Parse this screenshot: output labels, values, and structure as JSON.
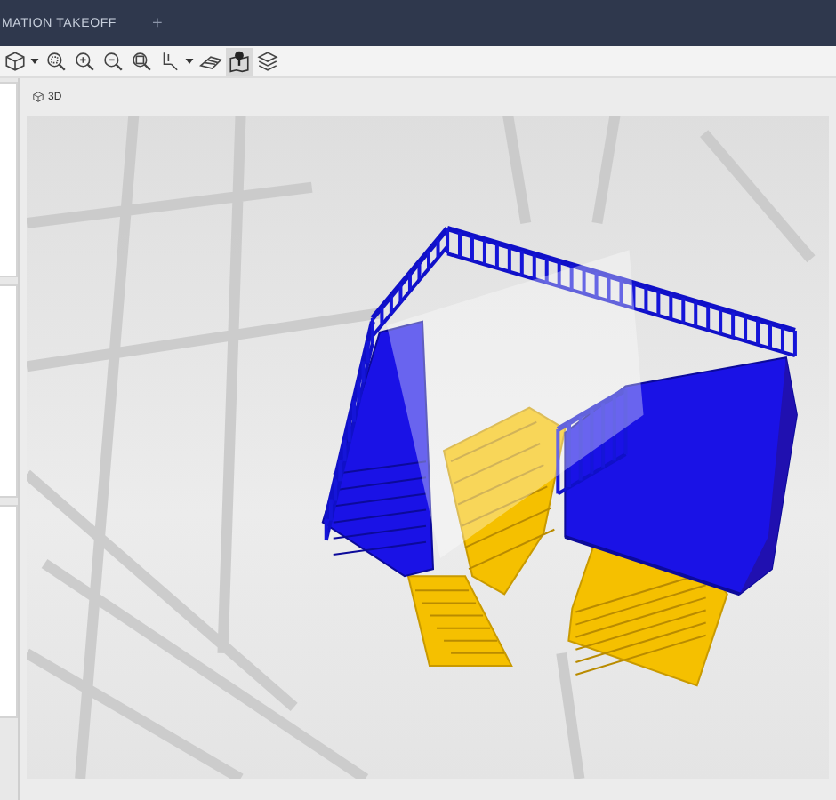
{
  "tabs": [
    {
      "label": "MATION TAKEOFF",
      "selected": true
    }
  ],
  "new_tab": "+",
  "toolbar": [
    {
      "kind": "cube",
      "dropdown": true,
      "selected": false
    },
    {
      "kind": "zoom-fit",
      "dropdown": false,
      "selected": false
    },
    {
      "kind": "zoom-in",
      "dropdown": false,
      "selected": false
    },
    {
      "kind": "zoom-out",
      "dropdown": false,
      "selected": false
    },
    {
      "kind": "zoom-window",
      "dropdown": false,
      "selected": false
    },
    {
      "kind": "pointer",
      "dropdown": true,
      "selected": false
    },
    {
      "kind": "plane",
      "dropdown": false,
      "selected": false
    },
    {
      "kind": "map-pin",
      "dropdown": false,
      "selected": true
    },
    {
      "kind": "layers",
      "dropdown": false,
      "selected": false
    }
  ],
  "view_tab": {
    "label": "3D"
  }
}
